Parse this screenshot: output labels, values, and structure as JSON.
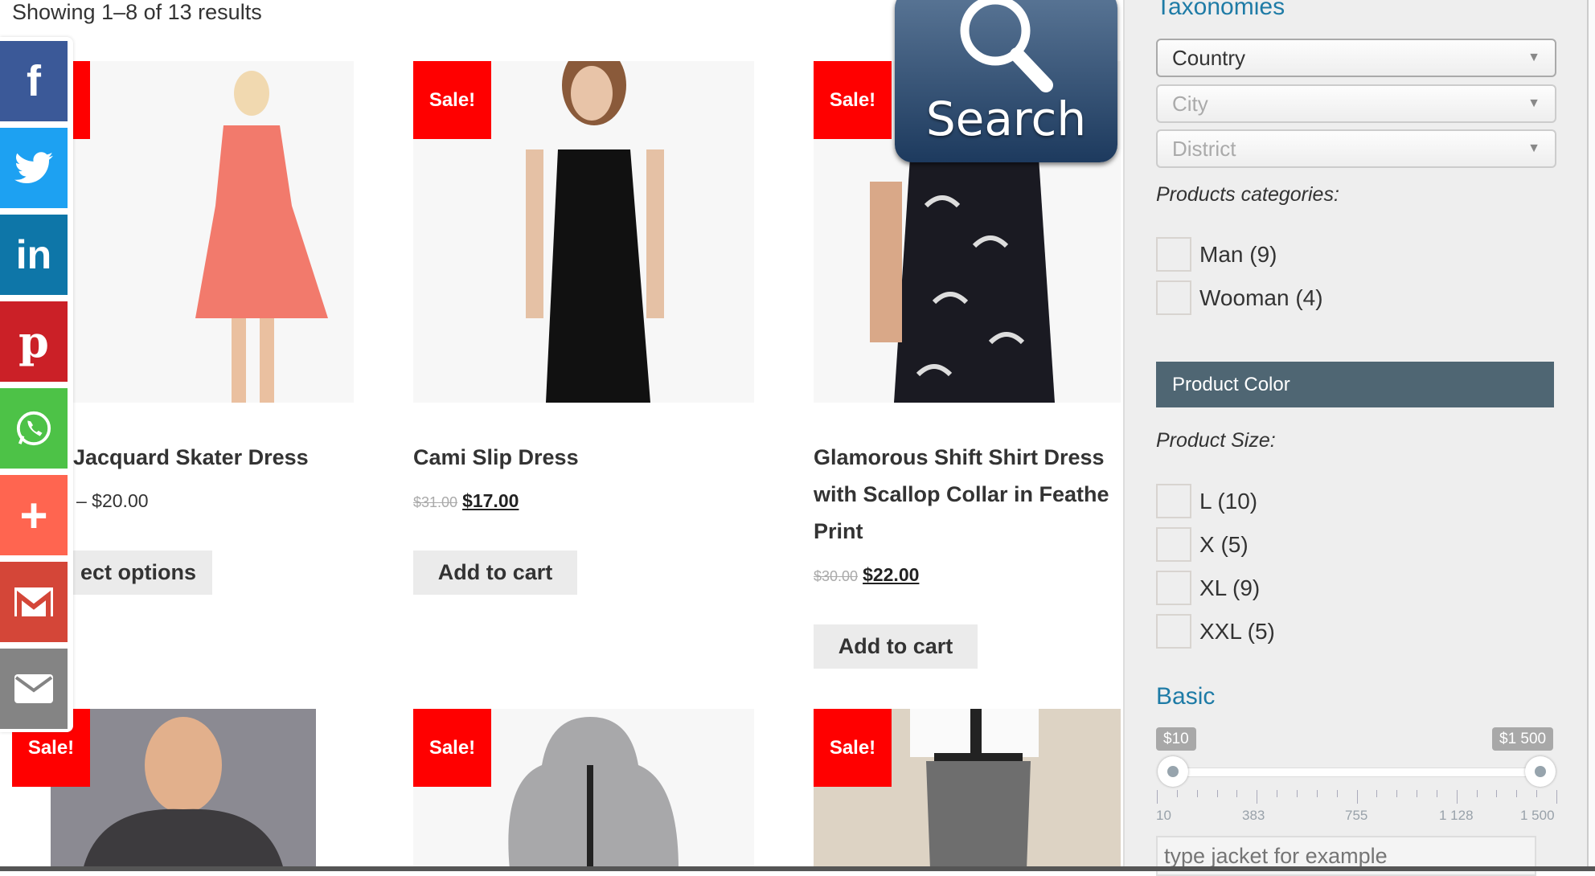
{
  "result_count": "Showing 1–8 of 13 results",
  "sale_label": "Sale!",
  "products": [
    {
      "title": "Jacquard Skater Dress",
      "price": "– $20.00",
      "button": "ect options"
    },
    {
      "title": "Cami Slip Dress",
      "old_price": "$31.00",
      "price": "$17.00",
      "button": "Add to cart"
    },
    {
      "title_lines": [
        "Glamorous Shift Shirt Dress",
        "with Scallop Collar in Feathe",
        "Print"
      ],
      "old_price": "$30.00",
      "price": "$22.00",
      "button": "Add to cart"
    }
  ],
  "social": [
    {
      "name": "facebook",
      "glyph": "f",
      "color": "#3b5998"
    },
    {
      "name": "twitter",
      "glyph": "🐦",
      "color": "#1da1f2"
    },
    {
      "name": "linkedin",
      "glyph": "in",
      "color": "#0e76a8"
    },
    {
      "name": "pinterest",
      "glyph": "P",
      "color": "#cb2027"
    },
    {
      "name": "whatsapp",
      "glyph": "✆",
      "color": "#4dc247"
    },
    {
      "name": "more",
      "glyph": "+",
      "color": "#ff6550"
    },
    {
      "name": "gmail",
      "glyph": "M",
      "color": "#d44638"
    },
    {
      "name": "email",
      "glyph": "✉",
      "color": "#848484"
    }
  ],
  "search_overlay": {
    "label": "Search"
  },
  "sidebar": {
    "taxonomies_title": "Taxonomies",
    "selects": [
      {
        "value": "Country",
        "active": true
      },
      {
        "value": "City",
        "active": false
      },
      {
        "value": "District",
        "active": false
      }
    ],
    "categories_label": "Products categories:",
    "categories": [
      "Man (9)",
      "Wooman (4)"
    ],
    "color_label": "Product Color",
    "size_label": "Product Size:",
    "sizes": [
      "L (10)",
      "X (5)",
      "XL (9)",
      "XXL (5)"
    ],
    "basic_title": "Basic",
    "price_min": "$10",
    "price_max": "$1 500",
    "slider_ticks": [
      "10",
      "383",
      "755",
      "1 128",
      "1 500"
    ],
    "keyword_placeholder": "type jacket for example"
  },
  "colors": {
    "sale": "#ff0000",
    "accent": "#1e7ba6",
    "color_bar": "#4f6673"
  }
}
